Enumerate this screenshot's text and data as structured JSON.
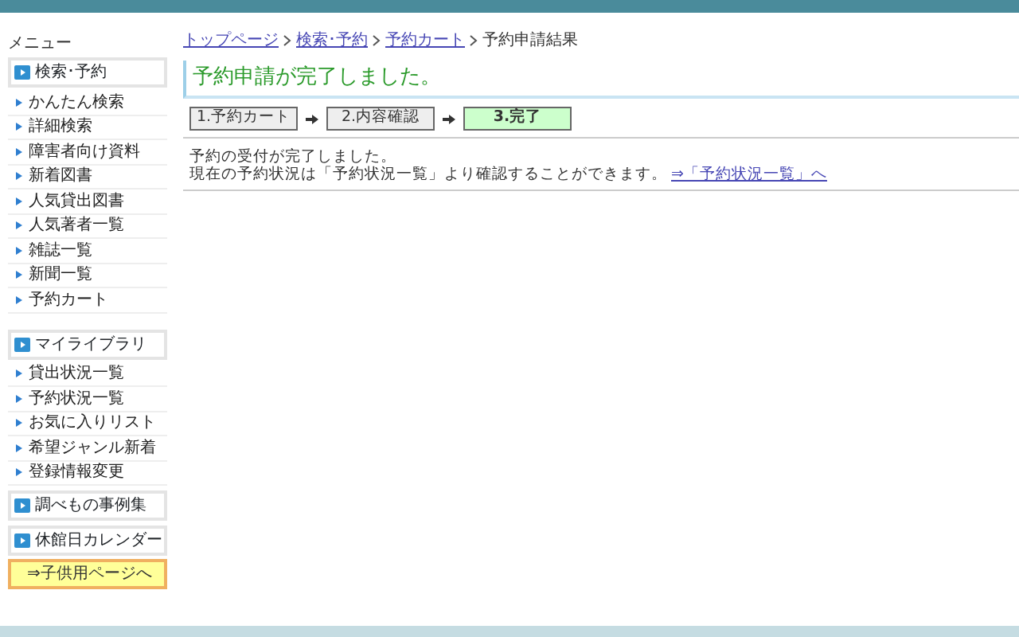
{
  "sidebar": {
    "title": "メニュー",
    "sections": [
      {
        "label": "検索･予約",
        "items": [
          "かんたん検索",
          "詳細検索",
          "障害者向け資料",
          "新着図書",
          "人気貸出図書",
          "人気著者一覧",
          "雑誌一覧",
          "新聞一覧",
          "予約カート"
        ]
      },
      {
        "label": "マイライブラリ",
        "items": [
          "貸出状況一覧",
          "予約状況一覧",
          "お気に入りリスト",
          "希望ジャンル新着",
          "登録情報変更"
        ]
      },
      {
        "label": "調べもの事例集"
      },
      {
        "label": "休館日カレンダー"
      }
    ],
    "kids_link": "⇒子供用ページへ"
  },
  "breadcrumb": {
    "links": [
      "トップページ",
      "検索･予約",
      "予約カート"
    ],
    "current": "予約申請結果"
  },
  "heading": "予約申請が完了しました。",
  "steps": [
    {
      "label": "1.予約カート",
      "selected": false
    },
    {
      "label": "2.内容確認",
      "selected": false
    },
    {
      "label": "3.完了",
      "selected": true
    }
  ],
  "message": {
    "line_1": "予約の受付が完了しました。",
    "line_2": "現在の予約状況は「予約状況一覧」より確認することができます。",
    "link": "⇒「予約状況一覧」へ"
  }
}
